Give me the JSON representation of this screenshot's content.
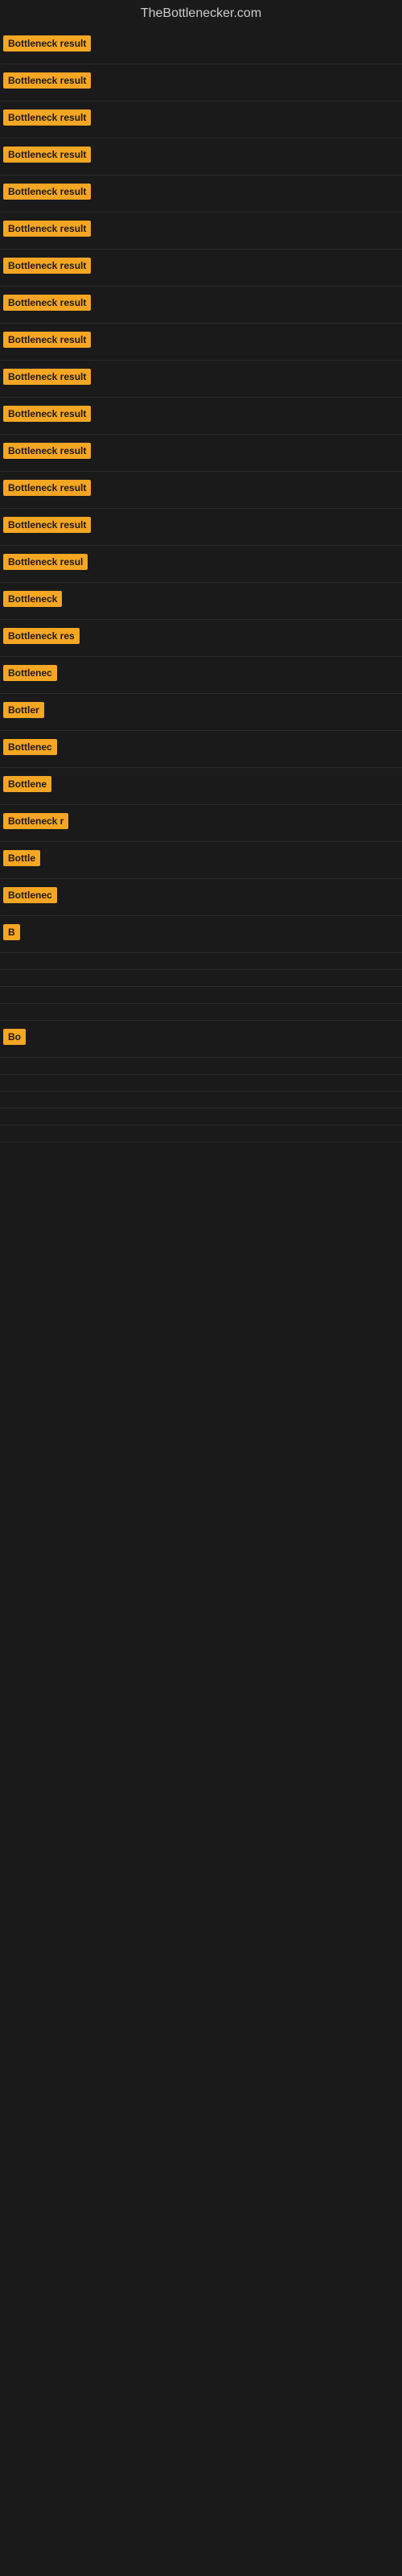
{
  "site": {
    "title": "TheBottlenecker.com"
  },
  "items": [
    {
      "label": "Bottleneck result",
      "width": 120
    },
    {
      "label": "Bottleneck result",
      "width": 120
    },
    {
      "label": "Bottleneck result",
      "width": 120
    },
    {
      "label": "Bottleneck result",
      "width": 120
    },
    {
      "label": "Bottleneck result",
      "width": 120
    },
    {
      "label": "Bottleneck result",
      "width": 120
    },
    {
      "label": "Bottleneck result",
      "width": 120
    },
    {
      "label": "Bottleneck result",
      "width": 120
    },
    {
      "label": "Bottleneck result",
      "width": 120
    },
    {
      "label": "Bottleneck result",
      "width": 120
    },
    {
      "label": "Bottleneck result",
      "width": 120
    },
    {
      "label": "Bottleneck result",
      "width": 120
    },
    {
      "label": "Bottleneck result",
      "width": 120
    },
    {
      "label": "Bottleneck result",
      "width": 120
    },
    {
      "label": "Bottleneck resul",
      "width": 110
    },
    {
      "label": "Bottleneck",
      "width": 78
    },
    {
      "label": "Bottleneck res",
      "width": 97
    },
    {
      "label": "Bottlenec",
      "width": 68
    },
    {
      "label": "Bottler",
      "width": 52
    },
    {
      "label": "Bottlenec",
      "width": 68
    },
    {
      "label": "Bottlene",
      "width": 60
    },
    {
      "label": "Bottleneck r",
      "width": 82
    },
    {
      "label": "Bottle",
      "width": 46
    },
    {
      "label": "Bottlenec",
      "width": 68
    },
    {
      "label": "B",
      "width": 14
    },
    {
      "label": "",
      "width": 4
    },
    {
      "label": "",
      "width": 0
    },
    {
      "label": "",
      "width": 0
    },
    {
      "label": "",
      "width": 0
    },
    {
      "label": "Bo",
      "width": 20
    },
    {
      "label": "",
      "width": 0
    },
    {
      "label": "",
      "width": 0
    },
    {
      "label": "",
      "width": 0
    },
    {
      "label": "",
      "width": 0
    },
    {
      "label": "",
      "width": 0
    }
  ]
}
